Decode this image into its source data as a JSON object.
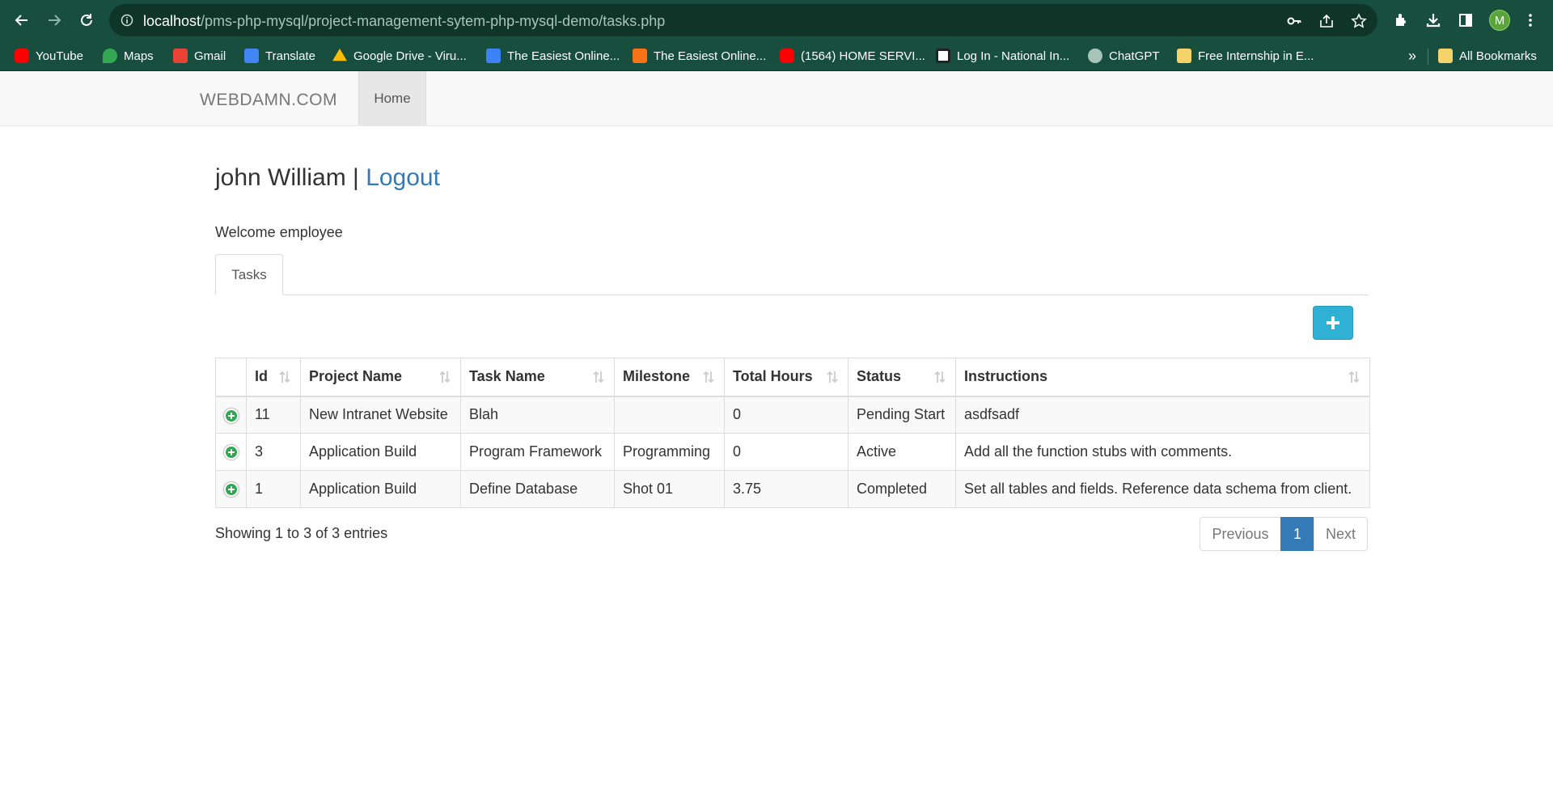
{
  "browser": {
    "url_host": "localhost",
    "url_path": "/pms-php-mysql/project-management-sytem-php-mysql-demo/tasks.php",
    "profile_initial": "M",
    "bookmarks": [
      {
        "label": "YouTube",
        "icon": "youtube-icon",
        "color": "#ff0000"
      },
      {
        "label": "Maps",
        "icon": "maps-icon",
        "color": "#34a853"
      },
      {
        "label": "Gmail",
        "icon": "gmail-icon",
        "color": "#ea4335"
      },
      {
        "label": "Translate",
        "icon": "translate-icon",
        "color": "#4285f4"
      },
      {
        "label": "Google Drive - Viru...",
        "icon": "drive-icon",
        "color": "#fbbc04"
      },
      {
        "label": "The Easiest Online...",
        "icon": "pen-icon",
        "color": "#3b82f6"
      },
      {
        "label": "The Easiest Online...",
        "icon": "flash-icon",
        "color": "#f97316"
      },
      {
        "label": "(1564) HOME SERVI...",
        "icon": "youtube-icon",
        "color": "#ff0000"
      },
      {
        "label": "Log In - National In...",
        "icon": "ni-icon",
        "color": "#ffffff"
      },
      {
        "label": "ChatGPT",
        "icon": "chatgpt-icon",
        "color": "#a7c4b9"
      },
      {
        "label": "Free Internship in E...",
        "icon": "note-icon",
        "color": "#f5d36b"
      }
    ],
    "overflow_label": "»",
    "all_bookmarks_label": "All Bookmarks"
  },
  "navbar": {
    "brand": "WEBDAMN.COM",
    "home_label": "Home"
  },
  "header": {
    "user_name": "john William",
    "separator": " | ",
    "logout_label": "Logout",
    "welcome": "Welcome employee"
  },
  "tabs": [
    {
      "label": "Tasks"
    }
  ],
  "table": {
    "columns": [
      "",
      "Id",
      "Project Name",
      "Task Name",
      "Milestone",
      "Total Hours",
      "Status",
      "Instructions"
    ],
    "rows": [
      {
        "id": "11",
        "project": "New Intranet Website",
        "task": "Blah",
        "milestone": "",
        "hours": "0",
        "status": "Pending Start",
        "instructions": "asdfsadf"
      },
      {
        "id": "3",
        "project": "Application Build",
        "task": "Program Framework",
        "milestone": "Programming",
        "hours": "0",
        "status": "Active",
        "instructions": "Add all the function stubs with comments."
      },
      {
        "id": "1",
        "project": "Application Build",
        "task": "Define Database",
        "milestone": "Shot 01",
        "hours": "3.75",
        "status": "Completed",
        "instructions": "Set all tables and fields. Reference data schema from client."
      }
    ]
  },
  "footer": {
    "info": "Showing 1 to 3 of 3 entries",
    "previous_label": "Previous",
    "current_page": "1",
    "next_label": "Next"
  },
  "colors": {
    "chrome": "#174e3e",
    "link": "#337ab7",
    "add_button": "#31b0d5",
    "expand_icon": "#2fa84f"
  }
}
